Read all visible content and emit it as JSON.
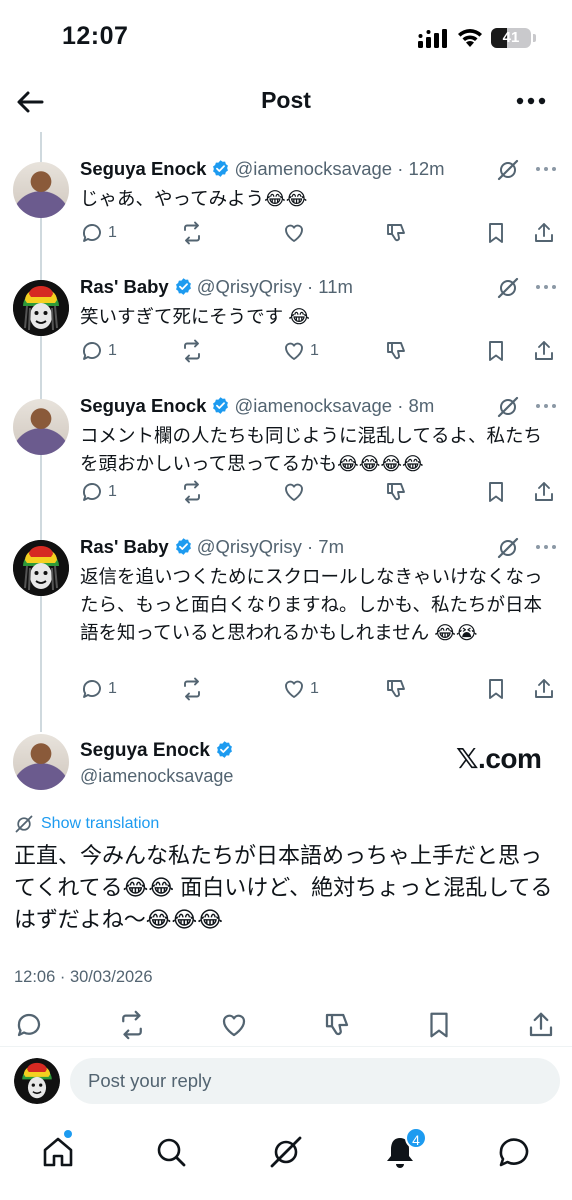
{
  "status_bar": {
    "time": "12:07",
    "battery": "41",
    "battery_level": 0.41
  },
  "header": {
    "title": "Post"
  },
  "replies": [
    {
      "avatar": "seguya",
      "name": "Seguya Enock",
      "handle": "@iamenocksavage",
      "time": "12m",
      "text": "じゃあ、やってみよう😂😂",
      "replies": "1",
      "likes": ""
    },
    {
      "avatar": "ras",
      "name": "Ras' Baby",
      "handle": "@QrisyQrisy",
      "time": "11m",
      "text": "笑いすぎて死にそうです 😂",
      "replies": "1",
      "likes": "1"
    },
    {
      "avatar": "seguya",
      "name": "Seguya Enock",
      "handle": "@iamenocksavage",
      "time": "8m",
      "text": "コメント欄の人たちも同じように混乱してるよ、私たちを頭おかしいって思ってるかも😂😂😂😂",
      "replies": "1",
      "likes": ""
    },
    {
      "avatar": "ras",
      "name": "Ras' Baby",
      "handle": "@QrisyQrisy",
      "time": "7m",
      "text": "返信を追いつくためにスクロールしなきゃいけなくなったら、もっと面白くなりますね。しかも、私たちが日本語を知っていると思われるかもしれません 😂😭",
      "replies": "1",
      "likes": "1"
    }
  ],
  "main_post": {
    "name": "Seguya Enock",
    "handle": "@iamenocksavage",
    "watermark": "𝕏.com",
    "translate_label": "Show translation",
    "text": "正直、今みんな私たちが日本語めっちゃ上手だと思ってくれてる😂😂 面白いけど、絶対ちょっと混乱してるはずだよね〜😂😂😂",
    "date": "12:06 · 30/03/2026"
  },
  "reply_bar": {
    "placeholder": "Post your reply"
  },
  "tabbar": {
    "notifications_badge": "4"
  },
  "colors": {
    "accent": "#1d9bf0",
    "muted": "#536471",
    "text": "#0f1419",
    "thread_line": "#cfd9de"
  }
}
